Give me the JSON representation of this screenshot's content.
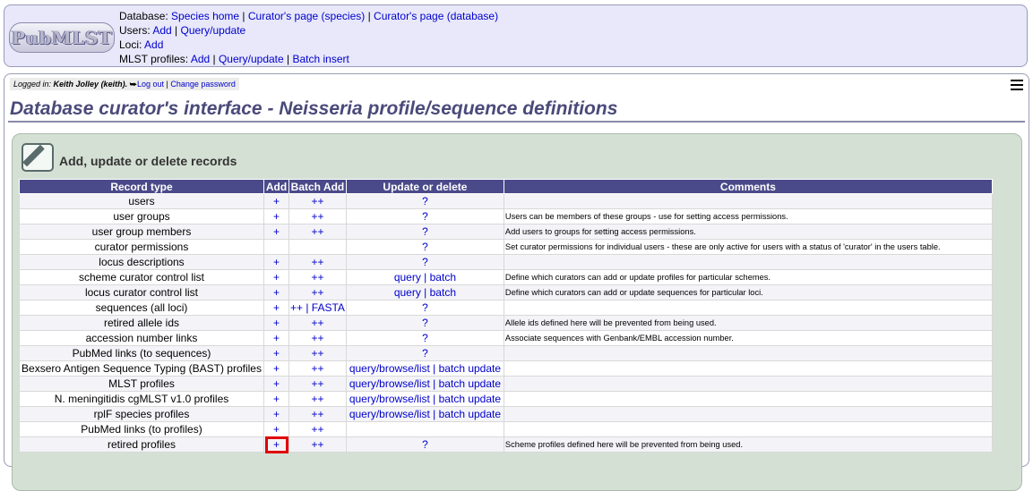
{
  "header": {
    "logo_text": "PubMLST",
    "database": {
      "label": "Database: ",
      "links": [
        "Species home",
        "Curator's page (species)",
        "Curator's page (database)"
      ]
    },
    "users": {
      "label": "Users: ",
      "links": [
        "Add",
        "Query/update"
      ]
    },
    "loci": {
      "label": "Loci: ",
      "links": [
        "Add"
      ]
    },
    "mlst_profiles": {
      "label": "MLST profiles: ",
      "links": [
        "Add",
        "Query/update",
        "Batch insert"
      ]
    }
  },
  "login": {
    "prefix": "Logged in: ",
    "user": "Keith Jolley (keith).",
    "logout": "Log out",
    "change_password": "Change password"
  },
  "page_title": "Database curator's interface - Neisseria profile/sequence definitions",
  "section": {
    "heading": "Add, update or delete records"
  },
  "table": {
    "headers": [
      "Record type",
      "Add",
      "Batch Add",
      "Update or delete",
      "Comments"
    ],
    "rows": [
      {
        "type": "users",
        "add": "+",
        "batch": "++",
        "update": "?",
        "comment": ""
      },
      {
        "type": "user groups",
        "add": "+",
        "batch": "++",
        "update": "?",
        "comment": "Users can be members of these groups - use for setting access permissions."
      },
      {
        "type": "user group members",
        "add": "+",
        "batch": "++",
        "update": "?",
        "comment": "Add users to groups for setting access permissions."
      },
      {
        "type": "curator permissions",
        "add": "",
        "batch": "",
        "update": "?",
        "comment": "Set curator permissions for individual users - these are only active for users with a status of 'curator' in the users table."
      },
      {
        "type": "locus descriptions",
        "add": "+",
        "batch": "++",
        "update": "?",
        "comment": ""
      },
      {
        "type": "scheme curator control list",
        "add": "+",
        "batch": "++",
        "update": "query | batch",
        "comment": "Define which curators can add or update profiles for particular schemes."
      },
      {
        "type": "locus curator control list",
        "add": "+",
        "batch": "++",
        "update": "query | batch",
        "comment": "Define which curators can add or update sequences for particular loci."
      },
      {
        "type": "sequences (all loci)",
        "add": "+",
        "batch": "++ | FASTA",
        "update": "?",
        "comment": ""
      },
      {
        "type": "retired allele ids",
        "add": "+",
        "batch": "++",
        "update": "?",
        "comment": "Allele ids defined here will be prevented from being used."
      },
      {
        "type": "accession number links",
        "add": "+",
        "batch": "++",
        "update": "?",
        "comment": "Associate sequences with Genbank/EMBL accession number."
      },
      {
        "type": "PubMed links (to sequences)",
        "add": "+",
        "batch": "++",
        "update": "?",
        "comment": ""
      },
      {
        "type": "Bexsero Antigen Sequence Typing (BAST) profiles",
        "add": "+",
        "batch": "++",
        "update": "query/browse/list | batch update",
        "comment": ""
      },
      {
        "type": "MLST profiles",
        "add": "+",
        "batch": "++",
        "update": "query/browse/list | batch update",
        "comment": ""
      },
      {
        "type": "N. meningitidis cgMLST v1.0 profiles",
        "add": "+",
        "batch": "++",
        "update": "query/browse/list | batch update",
        "comment": ""
      },
      {
        "type": "rplF species profiles",
        "add": "+",
        "batch": "++",
        "update": "query/browse/list | batch update",
        "comment": ""
      },
      {
        "type": "PubMed links (to profiles)",
        "add": "+",
        "batch": "++",
        "update": "",
        "comment": ""
      },
      {
        "type": "retired profiles",
        "add": "+",
        "batch": "++",
        "update": "?",
        "comment": "Scheme profiles defined here will be prevented from being used."
      }
    ]
  },
  "highlight_color": "#e00000",
  "header_color": "#4a4a8a"
}
